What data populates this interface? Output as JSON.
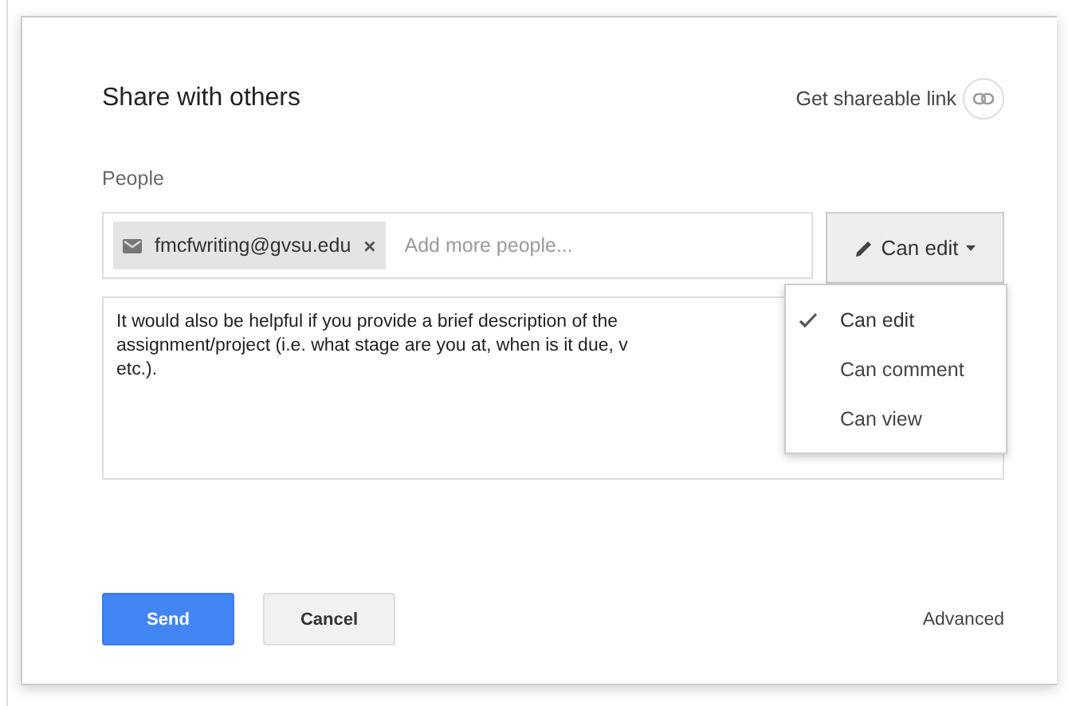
{
  "dialog": {
    "title": "Share with others",
    "link_label": "Get shareable link"
  },
  "people": {
    "label": "People",
    "chips": [
      {
        "email": "fmcfwriting@gvsu.edu",
        "remove": "×"
      }
    ],
    "placeholder": "Add more people...",
    "permission": {
      "label": "Can edit"
    }
  },
  "message": {
    "lines": [
      "It would also be helpful if you provide a brief description of the",
      "assignment/project (i.e. what stage are you at, when is it due, v",
      "etc.)."
    ]
  },
  "permission_menu": {
    "items": [
      {
        "label": "Can edit",
        "selected": true
      },
      {
        "label": "Can comment",
        "selected": false
      },
      {
        "label": "Can view",
        "selected": false
      }
    ]
  },
  "buttons": [
    {
      "label": "Send",
      "kind": "primary"
    },
    {
      "label": "Cancel",
      "kind": "secondary"
    }
  ],
  "advanced": "Advanced"
}
